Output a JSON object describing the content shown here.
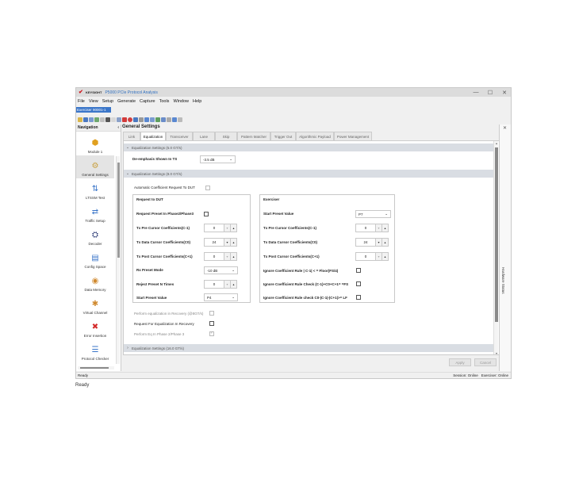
{
  "titlebar": {
    "brand": "KEYSIGHT",
    "title": "P5000 PCIe Protocol Analysis"
  },
  "window_controls": {
    "minimize": "—",
    "maximize": "☐",
    "close": "✕"
  },
  "menu": [
    "File",
    "View",
    "Setup",
    "Generate",
    "Capture",
    "Tools",
    "Window",
    "Help"
  ],
  "exerciser_tab": "Exerciser 90001-1",
  "nav": {
    "header": "Navigation",
    "collapse": "‹",
    "items": [
      {
        "label": "Module 1",
        "icon": "module-icon"
      },
      {
        "label": "General Settings",
        "icon": "settings-icon"
      },
      {
        "label": "LTSSM Test",
        "icon": "ltssm-icon"
      },
      {
        "label": "Traffic Setup",
        "icon": "traffic-icon"
      },
      {
        "label": "Decoder",
        "icon": "decoder-icon"
      },
      {
        "label": "Config Space",
        "icon": "config-icon"
      },
      {
        "label": "Data Memory",
        "icon": "memory-icon"
      },
      {
        "label": "Virtual Channel",
        "icon": "virtual-channel-icon"
      },
      {
        "label": "Error Insertion",
        "icon": "error-icon"
      },
      {
        "label": "Protocol Checker",
        "icon": "checker-icon"
      }
    ]
  },
  "main": {
    "title": "General Settings",
    "tabs": [
      "Link",
      "Equalization",
      "Transceiver",
      "Lane",
      "Skip",
      "Pattern Matcher",
      "Trigger Out",
      "Algorithmic Payload",
      "Power Management"
    ],
    "active_tab": "Equalization"
  },
  "eq5": {
    "header": "Equalization Settings (5.0 GT/s)",
    "deemph_label": "De-emphasis Shown In TS",
    "deemph_value": "-3.5 dB"
  },
  "eq8": {
    "header": "Equalization Settings (8.0 GT/s)",
    "auto_req_label": "Automatic Coefficient Request To DUT",
    "rtd": {
      "title": "Request to DUT",
      "preset_phase_label": "Request Preset In Phase2/Phase3",
      "pre_label": "Tx Pre Cursor Coefficients(C-1)",
      "pre_value": "0",
      "data_label": "Tx Data Cursor Coefficients(C0)",
      "data_value": "24",
      "post_label": "Tx Post Cursor Coefficients(C+1)",
      "post_value": "0",
      "rxmode_label": "Rx Preset Mode",
      "rxmode_value": "-10 dB",
      "reject_label": "Reject Preset N Times",
      "reject_value": "0",
      "start_label": "Start Preset Value",
      "start_value": "P4"
    },
    "ex": {
      "title": "Exerciser",
      "start_label": "Start Preset Value",
      "start_value": "P7",
      "pre_label": "Tx Pre Cursor Coefficients(C-1)",
      "pre_value": "0",
      "data_label": "Tx Data Cursor Coefficients(C0)",
      "data_value": "24",
      "post_label": "Tx Post Cursor Coefficients(C+1)",
      "post_value": "0",
      "rule1": "Ignore Coefficient Rule | C-1| < = Floor(FS/4)",
      "rule2": "Ignore Coefficient Rule Check (C-1)+C0+C+1= =FS",
      "rule3": "Ignore Coefficient Rule check C0-|C-1|-|C+1|>= LF"
    },
    "perform_recovery_label": "Perform equalization in Recovery (@8GT/s)",
    "request_recovery_label": "Request For Equalization In Recovery",
    "perform_phase_label": "Perform Eq In Phase 2/Phase 3"
  },
  "eq16": {
    "header": "Equalization Settings (16.0 GT/s)"
  },
  "side_panel": {
    "label": "Hardware Status",
    "close": "✕"
  },
  "buttons": {
    "apply": "Apply",
    "cancel": "Cancel"
  },
  "statusbar": {
    "left": "Ready",
    "session": "Session: Online",
    "exerciser": "Exerciser: Online"
  },
  "caption": "Ready"
}
